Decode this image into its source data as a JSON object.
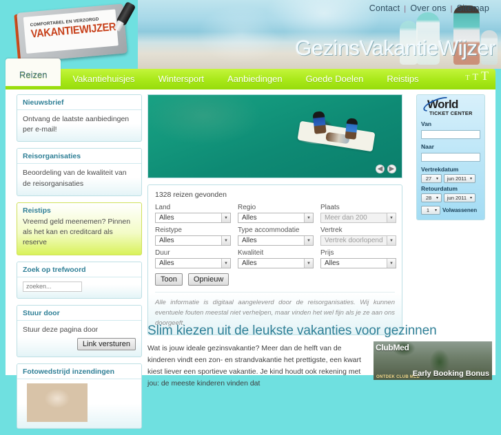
{
  "header": {
    "logo": {
      "tagline": "COMFORTABEL EN VERZORGD",
      "brand": "VAKANTIEWIJZER"
    },
    "site_title": "GezinsVakantieWijzer",
    "top_links": [
      {
        "label": "Contact"
      },
      {
        "label": "Over ons"
      },
      {
        "label": "Sitemap"
      }
    ],
    "separator": "|"
  },
  "nav": {
    "tabs": [
      {
        "label": "Reizen",
        "active": true
      },
      {
        "label": "Vakantiehuisjes",
        "active": false
      },
      {
        "label": "Wintersport",
        "active": false
      },
      {
        "label": "Aanbiedingen",
        "active": false
      },
      {
        "label": "Goede Doelen",
        "active": false
      },
      {
        "label": "Reistips",
        "active": false
      }
    ],
    "textsize": {
      "small": "T",
      "medium": "T",
      "large": "T"
    }
  },
  "sidebar": {
    "boxes": [
      {
        "title": "Nieuwsbrief",
        "body": "Ontvang de laatste aanbiedingen per e-mail!"
      },
      {
        "title": "Reisorganisaties",
        "body": "Beoordeling van de kwaliteit van de reisorganisaties"
      },
      {
        "title": "Reistips",
        "body": "Vreemd geld meenemen? Pinnen als het kan en creditcard als reserve"
      },
      {
        "title": "Zoek op trefwoord",
        "search_placeholder": "zoeken..."
      },
      {
        "title": "Stuur door",
        "body": "Stuur deze pagina door",
        "button": "Link versturen"
      },
      {
        "title": "Fotowedstrijd inzendingen"
      }
    ]
  },
  "hero": {
    "prev_arrow": "◀",
    "next_arrow": "▶"
  },
  "search_form": {
    "found_count": "1328 reizen gevonden",
    "rows": [
      [
        {
          "label": "Land",
          "value": "Alles",
          "disabled": false
        },
        {
          "label": "Regio",
          "value": "Alles",
          "disabled": false
        },
        {
          "label": "Plaats",
          "value": "Meer dan 200",
          "disabled": true
        }
      ],
      [
        {
          "label": "Reistype",
          "value": "Alles",
          "disabled": false
        },
        {
          "label": "Type accommodatie",
          "value": "Alles",
          "disabled": false
        },
        {
          "label": "Vertrek",
          "value": "Vertrek doorlopend",
          "disabled": true
        }
      ],
      [
        {
          "label": "Duur",
          "value": "Alles",
          "disabled": false
        },
        {
          "label": "Kwaliteit",
          "value": "Alles",
          "disabled": false
        },
        {
          "label": "Prijs",
          "value": "Alles",
          "disabled": false
        }
      ]
    ],
    "submit_label": "Toon",
    "reset_label": "Opnieuw",
    "disclaimer": "Alle informatie is digitaal aangeleverd door de reisorganisaties. Wij kunnen eventuele fouten meestal niet verhelpen, maar vinden het wel fijn als je ze aan ons doorgeeft."
  },
  "world_ticket_center": {
    "brand_word": "World",
    "brand_sub": "TICKET CENTER",
    "from_label": "Van",
    "from_value": "",
    "to_label": "Naar",
    "to_value": "",
    "depart_label": "Vertrekdatum",
    "depart_day": "27",
    "depart_month": "jun 2011",
    "return_label": "Retourdatum",
    "return_day": "28",
    "return_month": "jun 2011",
    "adults_value": "1",
    "adults_label": "Volwassenen",
    "arrow_glyph": "▾"
  },
  "article": {
    "title": "Slim kiezen uit de leukste vakanties voor gezinnen",
    "body": "Wat is jouw ideale gezinsvakantie? Meer dan de helft van de kinderen vindt een zon- en strandvakantie het prettigste, een kwart kiest liever een sportieve vakantie. Je kind houdt ook rekening met jou: de meeste kinderen vinden dat"
  },
  "advertisement": {
    "brand": "ClubMed",
    "headline": "Early Booking Bonus",
    "footnote": "ONTDEK CLUB MED"
  },
  "colors": {
    "page_background": "#6fe0e0",
    "nav_green": "#a8e818",
    "accent_teal": "#2f7f96",
    "logo_orange": "#c7401a",
    "tip_green": "#d9f25a"
  }
}
